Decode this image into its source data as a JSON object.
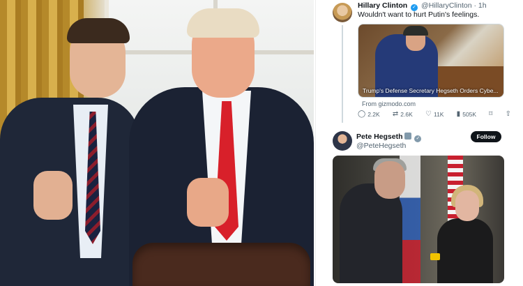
{
  "tweet1": {
    "name": "Hillary Clinton",
    "handle": "@HillaryClinton",
    "time": "· 1h",
    "text": "Wouldn't want to hurt Putin's feelings.",
    "card_title": "Trump's Defense Secretary Hegseth Orders Cybe...",
    "card_source": "From gizmodo.com",
    "metrics": {
      "replies": "2.2K",
      "reposts": "2.6K",
      "likes": "11K",
      "views": "505K"
    }
  },
  "tweet2": {
    "name": "Pete Hegseth",
    "handle": "@PeteHegseth",
    "follow_label": "Follow"
  },
  "icons": [
    "reply-icon",
    "repost-icon",
    "like-icon",
    "views-icon",
    "bookmark-icon",
    "share-icon",
    "verified-badge-icon"
  ],
  "colors": {
    "verified_blue": "#1d9bf0",
    "follow_button": "#0f1419",
    "muted_text": "#536471"
  }
}
